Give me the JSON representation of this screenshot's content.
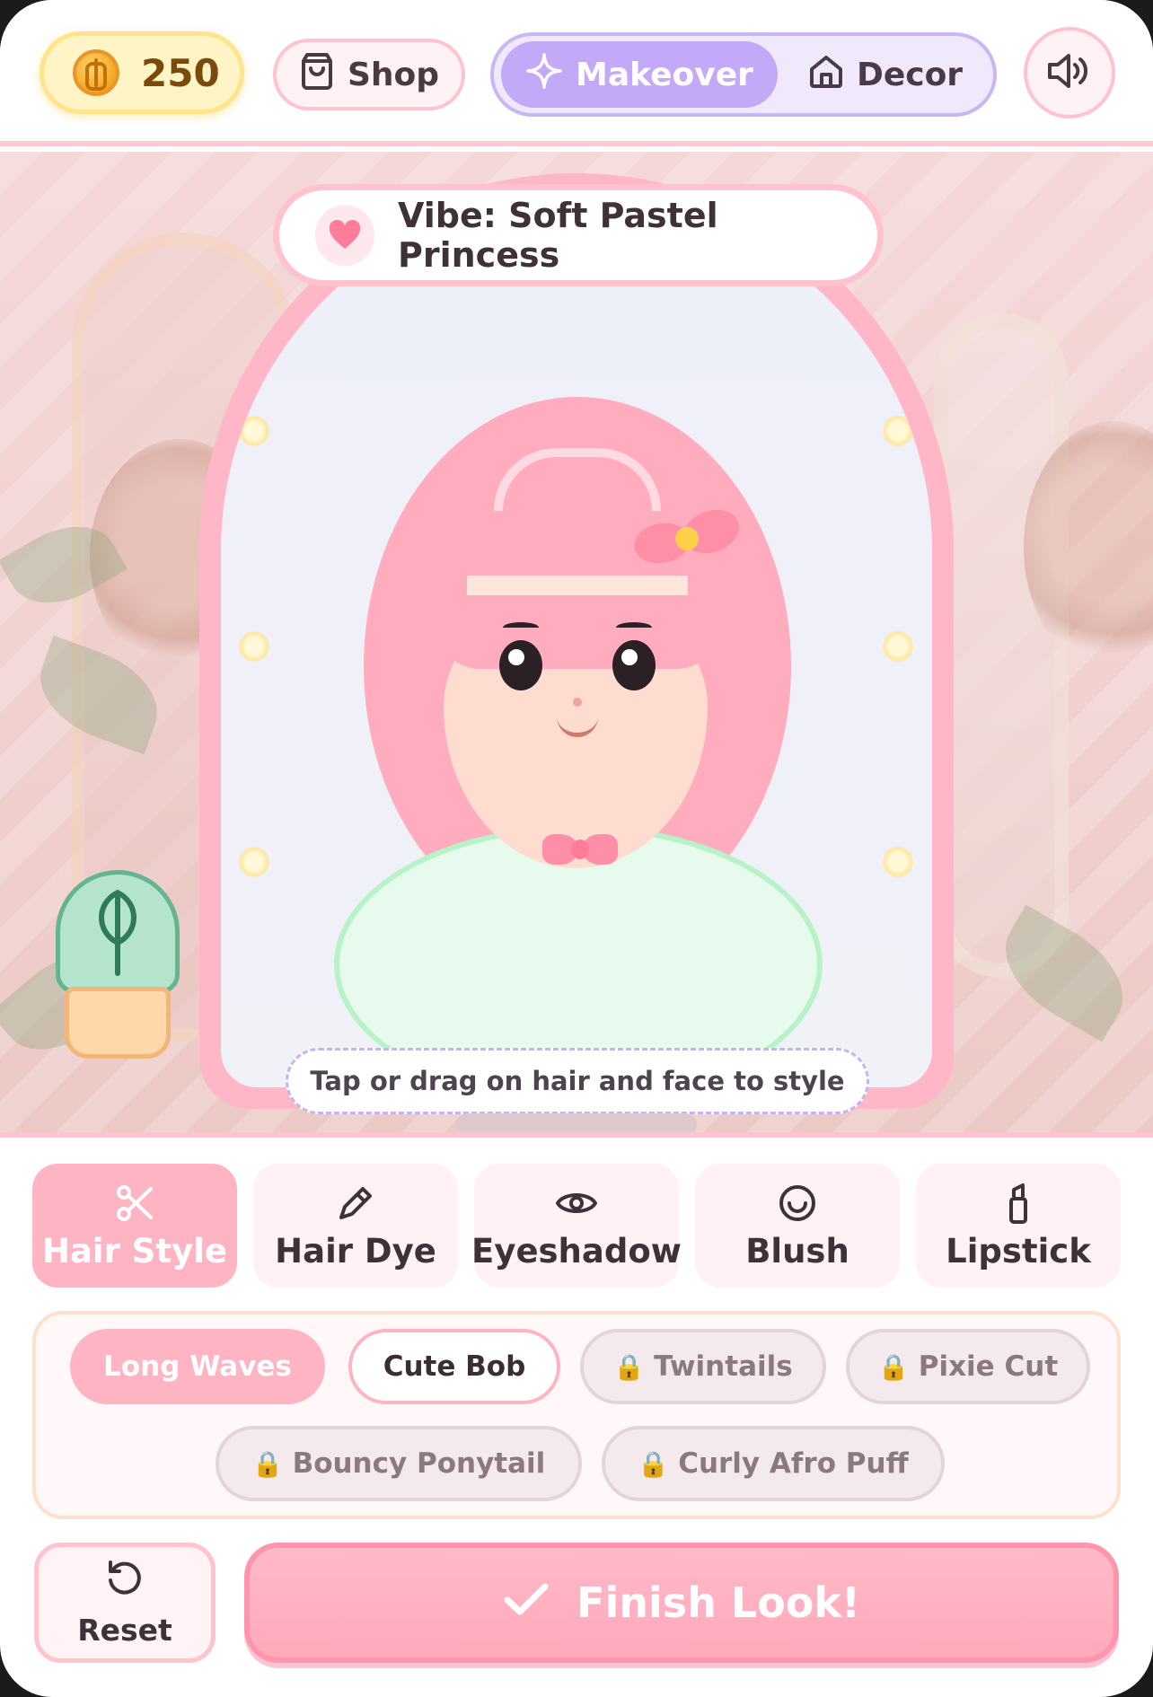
{
  "header": {
    "coins": "250",
    "shop_label": "Shop",
    "mode_tabs": [
      {
        "label": "Makeover",
        "icon": "sparkle-icon",
        "active": true
      },
      {
        "label": "Decor",
        "icon": "home-icon",
        "active": false
      }
    ],
    "sound_icon": "speaker-icon"
  },
  "stage": {
    "vibe_label": "Vibe: Soft Pastel Princess",
    "hint": "Tap or drag on hair and face to style"
  },
  "categories": [
    {
      "label": "Hair Style",
      "icon": "scissors-icon",
      "active": true
    },
    {
      "label": "Hair Dye",
      "icon": "brush-icon",
      "active": false
    },
    {
      "label": "Eyeshadow",
      "icon": "eye-icon",
      "active": false
    },
    {
      "label": "Blush",
      "icon": "smile-icon",
      "active": false
    },
    {
      "label": "Lipstick",
      "icon": "lipstick-icon",
      "active": false
    }
  ],
  "options": [
    {
      "label": "Long Waves",
      "state": "selected"
    },
    {
      "label": "Cute Bob",
      "state": "available"
    },
    {
      "label": "Twintails",
      "state": "locked"
    },
    {
      "label": "Pixie Cut",
      "state": "locked"
    },
    {
      "label": "Bouncy Ponytail",
      "state": "locked"
    },
    {
      "label": "Curly Afro Puff",
      "state": "locked"
    }
  ],
  "actions": {
    "reset_label": "Reset",
    "finish_label": "Finish Look!"
  },
  "colors": {
    "accent_pink": "#ffb4c4",
    "accent_lavender": "#c3a9f7",
    "coin_gold": "#f5a623",
    "mint": "#b7f3c6"
  }
}
